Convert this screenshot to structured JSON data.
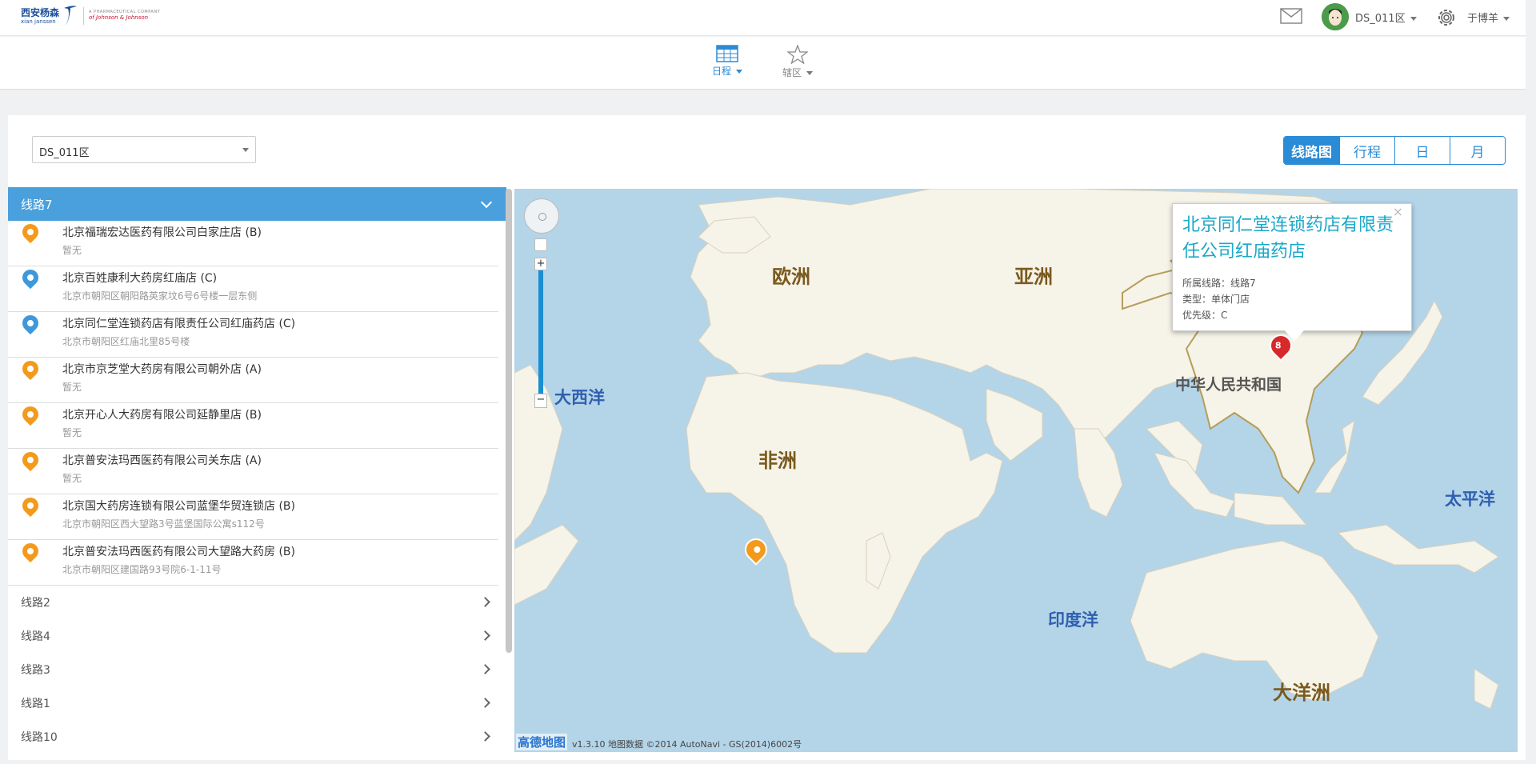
{
  "header": {
    "logo_cn": "西安杨森",
    "logo_en": "xian janssen",
    "logo_sub1": "A PHARMACEUTICAL COMPANY",
    "logo_sub2": "of Johnson & Johnson",
    "zone": "DS_011区",
    "user": "于博羊"
  },
  "nav": {
    "schedule": "日程",
    "area": "辖区"
  },
  "filter": {
    "zone_value": "DS_011区"
  },
  "views": [
    "线路图",
    "行程",
    "日",
    "月"
  ],
  "routes": {
    "active": "线路7",
    "items": [
      {
        "name": "北京福瑞宏达医药有限公司白家庄店 (B)",
        "addr": "暂无",
        "color": "#f39a1d"
      },
      {
        "name": "北京百姓康利大药房红庙店 (C)",
        "addr": "北京市朝阳区朝阳路英家坟6号6号楼一层东侧",
        "color": "#3e98d9"
      },
      {
        "name": "北京同仁堂连锁药店有限责任公司红庙药店 (C)",
        "addr": "北京市朝阳区红庙北里85号楼",
        "color": "#3e98d9"
      },
      {
        "name": "北京市京芝堂大药房有限公司朝外店 (A)",
        "addr": "暂无",
        "color": "#f39a1d"
      },
      {
        "name": "北京开心人大药房有限公司延静里店 (B)",
        "addr": "暂无",
        "color": "#f39a1d"
      },
      {
        "name": "北京普安法玛西医药有限公司关东店 (A)",
        "addr": "暂无",
        "color": "#f39a1d"
      },
      {
        "name": "北京国大药房连锁有限公司蓝堡华贸连锁店 (B)",
        "addr": "北京市朝阳区西大望路3号蓝堡国际公寓s112号",
        "color": "#f39a1d"
      },
      {
        "name": "北京普安法玛西医药有限公司大望路大药房 (B)",
        "addr": "北京市朝阳区建国路93号院6-1-11号",
        "color": "#f39a1d"
      }
    ],
    "collapsed": [
      "线路2",
      "线路4",
      "线路3",
      "线路1",
      "线路10"
    ]
  },
  "map": {
    "labels": {
      "europe": "欧洲",
      "asia": "亚洲",
      "africa": "非洲",
      "oceania": "大洋洲",
      "atlantic": "大西洋",
      "indian": "印度洋",
      "pacific": "太平洋",
      "china": "中华人民共和国"
    },
    "popup": {
      "title": "北京同仁堂连锁药店有限责任公司红庙药店",
      "route": "所属线路：线路7",
      "type": "类型：单体门店",
      "priority": "优先级：C"
    },
    "marker_number": "8",
    "attribution_logo": "高德地图",
    "attribution": "v1.3.10 地图数据 ©2014 AutoNavi - GS(2014)6002号"
  }
}
